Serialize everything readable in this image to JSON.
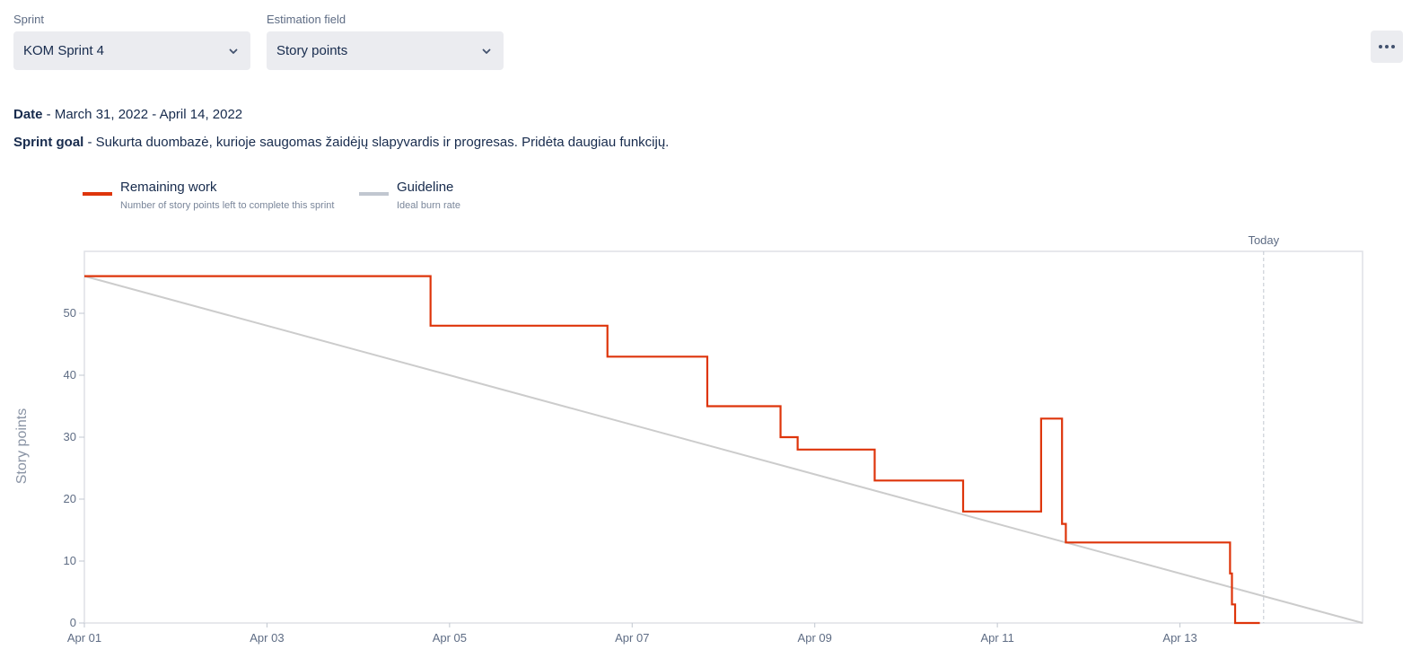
{
  "controls": {
    "sprint": {
      "label": "Sprint",
      "value": "KOM Sprint 4"
    },
    "estimation": {
      "label": "Estimation field",
      "value": "Story points"
    }
  },
  "info": {
    "date_label": "Date",
    "date_value": " - March 31, 2022 - April 14, 2022",
    "goal_label": "Sprint goal",
    "goal_value": " - Sukurta duombazė, kurioje saugomas žaidėjų slapyvardis ir progresas. Pridėta daugiau funkcijų."
  },
  "legend": [
    {
      "title": "Remaining work",
      "subtitle": "Number of story points left to complete this sprint",
      "color": "#de350b"
    },
    {
      "title": "Guideline",
      "subtitle": "Ideal burn rate",
      "color": "#c1c7d0"
    }
  ],
  "colors": {
    "remaining": "#de350b",
    "guideline": "#cccccc",
    "today": "#c1c7d0",
    "axis": "#dfe1e6"
  },
  "icons": {
    "dropdown": "chevron-down-icon",
    "more": "more-icon"
  },
  "chart_data": {
    "type": "line",
    "title": "",
    "xlabel": "",
    "ylabel": "Story points",
    "today_label": "Today",
    "xlim": [
      "2022-04-01T00:00",
      "2022-04-15T00:00"
    ],
    "ylim": [
      0,
      60
    ],
    "y_ticks": [
      0,
      10,
      20,
      30,
      40,
      50
    ],
    "x_ticks": [
      {
        "date": "2022-04-01",
        "label": "Apr 01"
      },
      {
        "date": "2022-04-03",
        "label": "Apr 03"
      },
      {
        "date": "2022-04-05",
        "label": "Apr 05"
      },
      {
        "date": "2022-04-07",
        "label": "Apr 07"
      },
      {
        "date": "2022-04-09",
        "label": "Apr 09"
      },
      {
        "date": "2022-04-11",
        "label": "Apr 11"
      },
      {
        "date": "2022-04-13",
        "label": "Apr 13"
      }
    ],
    "today": "2022-04-13T22:00",
    "grid": false,
    "legend_position": "top-left",
    "series": [
      {
        "name": "Remaining work",
        "step": true,
        "points": [
          [
            "2022-04-01T00:00",
            56
          ],
          [
            "2022-04-04T19:00",
            48
          ],
          [
            "2022-04-06T17:30",
            43
          ],
          [
            "2022-04-07T19:45",
            35
          ],
          [
            "2022-04-08T15:00",
            30
          ],
          [
            "2022-04-08T19:30",
            28
          ],
          [
            "2022-04-09T15:45",
            23
          ],
          [
            "2022-04-10T15:00",
            18
          ],
          [
            "2022-04-11T11:30",
            33
          ],
          [
            "2022-04-11T17:00",
            16
          ],
          [
            "2022-04-11T18:00",
            13
          ],
          [
            "2022-04-13T13:10",
            8
          ],
          [
            "2022-04-13T13:40",
            3
          ],
          [
            "2022-04-13T14:30",
            0
          ],
          [
            "2022-04-13T21:00",
            0
          ]
        ]
      },
      {
        "name": "Guideline",
        "step": false,
        "points": [
          [
            "2022-04-01T00:00",
            56
          ],
          [
            "2022-04-15T00:00",
            0
          ]
        ]
      }
    ]
  }
}
